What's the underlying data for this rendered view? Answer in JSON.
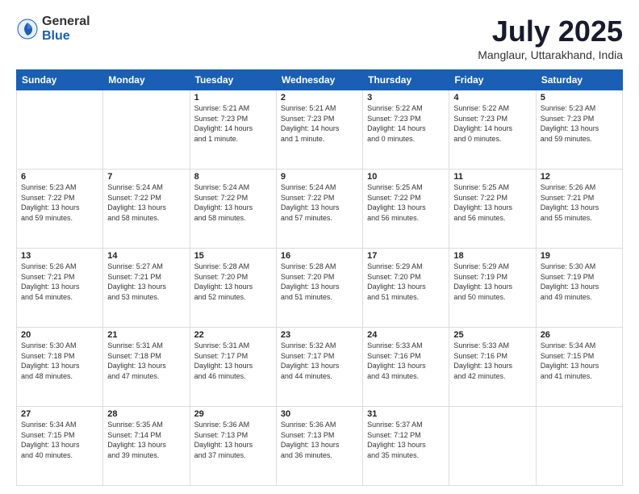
{
  "header": {
    "logo_general": "General",
    "logo_blue": "Blue",
    "month_title": "July 2025",
    "location": "Manglaur, Uttarakhand, India"
  },
  "weekdays": [
    "Sunday",
    "Monday",
    "Tuesday",
    "Wednesday",
    "Thursday",
    "Friday",
    "Saturday"
  ],
  "weeks": [
    [
      {
        "day": "",
        "info": ""
      },
      {
        "day": "",
        "info": ""
      },
      {
        "day": "1",
        "info": "Sunrise: 5:21 AM\nSunset: 7:23 PM\nDaylight: 14 hours\nand 1 minute."
      },
      {
        "day": "2",
        "info": "Sunrise: 5:21 AM\nSunset: 7:23 PM\nDaylight: 14 hours\nand 1 minute."
      },
      {
        "day": "3",
        "info": "Sunrise: 5:22 AM\nSunset: 7:23 PM\nDaylight: 14 hours\nand 0 minutes."
      },
      {
        "day": "4",
        "info": "Sunrise: 5:22 AM\nSunset: 7:23 PM\nDaylight: 14 hours\nand 0 minutes."
      },
      {
        "day": "5",
        "info": "Sunrise: 5:23 AM\nSunset: 7:23 PM\nDaylight: 13 hours\nand 59 minutes."
      }
    ],
    [
      {
        "day": "6",
        "info": "Sunrise: 5:23 AM\nSunset: 7:22 PM\nDaylight: 13 hours\nand 59 minutes."
      },
      {
        "day": "7",
        "info": "Sunrise: 5:24 AM\nSunset: 7:22 PM\nDaylight: 13 hours\nand 58 minutes."
      },
      {
        "day": "8",
        "info": "Sunrise: 5:24 AM\nSunset: 7:22 PM\nDaylight: 13 hours\nand 58 minutes."
      },
      {
        "day": "9",
        "info": "Sunrise: 5:24 AM\nSunset: 7:22 PM\nDaylight: 13 hours\nand 57 minutes."
      },
      {
        "day": "10",
        "info": "Sunrise: 5:25 AM\nSunset: 7:22 PM\nDaylight: 13 hours\nand 56 minutes."
      },
      {
        "day": "11",
        "info": "Sunrise: 5:25 AM\nSunset: 7:22 PM\nDaylight: 13 hours\nand 56 minutes."
      },
      {
        "day": "12",
        "info": "Sunrise: 5:26 AM\nSunset: 7:21 PM\nDaylight: 13 hours\nand 55 minutes."
      }
    ],
    [
      {
        "day": "13",
        "info": "Sunrise: 5:26 AM\nSunset: 7:21 PM\nDaylight: 13 hours\nand 54 minutes."
      },
      {
        "day": "14",
        "info": "Sunrise: 5:27 AM\nSunset: 7:21 PM\nDaylight: 13 hours\nand 53 minutes."
      },
      {
        "day": "15",
        "info": "Sunrise: 5:28 AM\nSunset: 7:20 PM\nDaylight: 13 hours\nand 52 minutes."
      },
      {
        "day": "16",
        "info": "Sunrise: 5:28 AM\nSunset: 7:20 PM\nDaylight: 13 hours\nand 51 minutes."
      },
      {
        "day": "17",
        "info": "Sunrise: 5:29 AM\nSunset: 7:20 PM\nDaylight: 13 hours\nand 51 minutes."
      },
      {
        "day": "18",
        "info": "Sunrise: 5:29 AM\nSunset: 7:19 PM\nDaylight: 13 hours\nand 50 minutes."
      },
      {
        "day": "19",
        "info": "Sunrise: 5:30 AM\nSunset: 7:19 PM\nDaylight: 13 hours\nand 49 minutes."
      }
    ],
    [
      {
        "day": "20",
        "info": "Sunrise: 5:30 AM\nSunset: 7:18 PM\nDaylight: 13 hours\nand 48 minutes."
      },
      {
        "day": "21",
        "info": "Sunrise: 5:31 AM\nSunset: 7:18 PM\nDaylight: 13 hours\nand 47 minutes."
      },
      {
        "day": "22",
        "info": "Sunrise: 5:31 AM\nSunset: 7:17 PM\nDaylight: 13 hours\nand 46 minutes."
      },
      {
        "day": "23",
        "info": "Sunrise: 5:32 AM\nSunset: 7:17 PM\nDaylight: 13 hours\nand 44 minutes."
      },
      {
        "day": "24",
        "info": "Sunrise: 5:33 AM\nSunset: 7:16 PM\nDaylight: 13 hours\nand 43 minutes."
      },
      {
        "day": "25",
        "info": "Sunrise: 5:33 AM\nSunset: 7:16 PM\nDaylight: 13 hours\nand 42 minutes."
      },
      {
        "day": "26",
        "info": "Sunrise: 5:34 AM\nSunset: 7:15 PM\nDaylight: 13 hours\nand 41 minutes."
      }
    ],
    [
      {
        "day": "27",
        "info": "Sunrise: 5:34 AM\nSunset: 7:15 PM\nDaylight: 13 hours\nand 40 minutes."
      },
      {
        "day": "28",
        "info": "Sunrise: 5:35 AM\nSunset: 7:14 PM\nDaylight: 13 hours\nand 39 minutes."
      },
      {
        "day": "29",
        "info": "Sunrise: 5:36 AM\nSunset: 7:13 PM\nDaylight: 13 hours\nand 37 minutes."
      },
      {
        "day": "30",
        "info": "Sunrise: 5:36 AM\nSunset: 7:13 PM\nDaylight: 13 hours\nand 36 minutes."
      },
      {
        "day": "31",
        "info": "Sunrise: 5:37 AM\nSunset: 7:12 PM\nDaylight: 13 hours\nand 35 minutes."
      },
      {
        "day": "",
        "info": ""
      },
      {
        "day": "",
        "info": ""
      }
    ]
  ]
}
